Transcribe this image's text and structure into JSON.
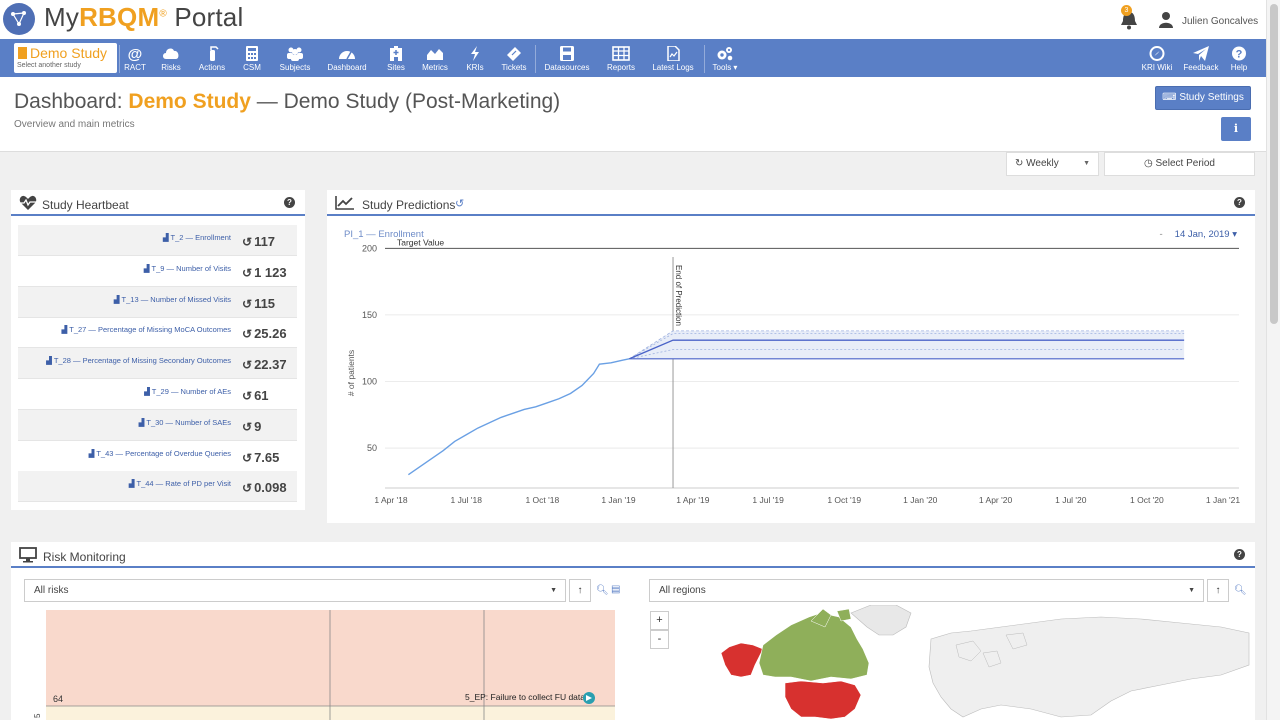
{
  "app": {
    "brand_prefix": "My",
    "brand_accent": "RBQM",
    "brand_reg": "®",
    "brand_suffix": " Portal",
    "notification_count": "3",
    "username": "Julien Goncalves"
  },
  "nav": {
    "study_name": "Demo Study",
    "study_hint": "Select another study",
    "items": [
      {
        "label": "RACT",
        "icon": "at-icon"
      },
      {
        "label": "Risks",
        "icon": "cloud-icon"
      },
      {
        "label": "Actions",
        "icon": "fire-extinguisher-icon"
      },
      {
        "label": "CSM",
        "icon": "calculator-icon"
      },
      {
        "label": "Subjects",
        "icon": "users-icon"
      },
      {
        "label": "Dashboard",
        "icon": "dashboard-icon"
      },
      {
        "label": "Sites",
        "icon": "hospital-icon"
      },
      {
        "label": "Metrics",
        "icon": "area-chart-icon"
      },
      {
        "label": "KRIs",
        "icon": "bolt-icon"
      },
      {
        "label": "Tickets",
        "icon": "ticket-icon"
      },
      {
        "label": "Datasources",
        "icon": "save-icon"
      },
      {
        "label": "Reports",
        "icon": "table-icon"
      },
      {
        "label": "Latest Logs",
        "icon": "file-icon"
      },
      {
        "label": "Tools ▾",
        "icon": "cogs-icon"
      }
    ],
    "right_items": [
      {
        "label": "KRI Wiki",
        "icon": "compass-icon"
      },
      {
        "label": "Feedback",
        "icon": "paper-plane-icon"
      },
      {
        "label": "Help",
        "icon": "question-icon"
      }
    ]
  },
  "header": {
    "title_prefix": "Dashboard: ",
    "title_study": "Demo Study",
    "title_suffix": " — Demo Study (Post-Marketing)",
    "subtitle": "Overview and main metrics",
    "settings_button": "Study Settings",
    "info_button": "i"
  },
  "period": {
    "frequency": "Weekly",
    "select_label": "Select Period"
  },
  "heartbeat": {
    "title": "Study Heartbeat",
    "rows": [
      {
        "label": "T_2 — Enrollment",
        "value": "117"
      },
      {
        "label": "T_9 — Number of Visits",
        "value": "1 123"
      },
      {
        "label": "T_13 — Number of Missed Visits",
        "value": "115"
      },
      {
        "label": "T_27 — Percentage of Missing MoCA Outcomes",
        "value": "25.26"
      },
      {
        "label": "T_28 — Percentage of Missing Secondary Outcomes",
        "value": "22.37"
      },
      {
        "label": "T_29 — Number of AEs",
        "value": "61"
      },
      {
        "label": "T_30 — Number of SAEs",
        "value": "9"
      },
      {
        "label": "T_43 — Percentage of Overdue Queries",
        "value": "7.65"
      },
      {
        "label": "T_44 — Rate of PD per Visit",
        "value": "0.098"
      }
    ]
  },
  "predictions": {
    "title": "Study Predictions",
    "subtitle": "PI_1 — Enrollment",
    "date_dash": "-",
    "date": "14 Jan, 2019 ▾",
    "target_label": "Target Value",
    "end_label": "End of Prediction"
  },
  "chart_data": {
    "type": "line",
    "title": "",
    "xlabel": "",
    "ylabel": "# of patients",
    "x_ticks": [
      "1 Apr '18",
      "1 Jul '18",
      "1 Oct '18",
      "1 Jan '19",
      "1 Apr '19",
      "1 Jul '19",
      "1 Oct '19",
      "1 Jan '20",
      "1 Apr '20",
      "1 Jul '20",
      "1 Oct '20",
      "1 Jan '21"
    ],
    "y_ticks": [
      50,
      100,
      150,
      200
    ],
    "ylim": [
      20,
      210
    ],
    "target_value": 200,
    "end_of_prediction": "2019-03-08",
    "grid": true,
    "series": [
      {
        "values": [
          {
            "x": "2018-04-22",
            "y": 30
          },
          {
            "x": "2018-05-06",
            "y": 36
          },
          {
            "x": "2018-05-20",
            "y": 42
          },
          {
            "x": "2018-06-03",
            "y": 48
          },
          {
            "x": "2018-06-17",
            "y": 55
          },
          {
            "x": "2018-07-01",
            "y": 60
          },
          {
            "x": "2018-07-15",
            "y": 65
          },
          {
            "x": "2018-07-29",
            "y": 69
          },
          {
            "x": "2018-08-12",
            "y": 73
          },
          {
            "x": "2018-08-26",
            "y": 76
          },
          {
            "x": "2018-09-09",
            "y": 79
          },
          {
            "x": "2018-09-23",
            "y": 81
          },
          {
            "x": "2018-10-07",
            "y": 84
          },
          {
            "x": "2018-10-21",
            "y": 87
          },
          {
            "x": "2018-11-04",
            "y": 91
          },
          {
            "x": "2018-11-18",
            "y": 97
          },
          {
            "x": "2018-12-02",
            "y": 106
          },
          {
            "x": "2018-12-09",
            "y": 113
          },
          {
            "x": "2018-12-23",
            "y": 114
          },
          {
            "x": "2019-01-06",
            "y": 116
          },
          {
            "x": "2019-01-14",
            "y": 117
          }
        ]
      }
    ],
    "prediction": {
      "start": {
        "x": "2019-01-14",
        "y": 117
      },
      "end_x": "2020-11-15",
      "upper": 138,
      "upper_inner": 136,
      "center": 131,
      "lower_inner": 124,
      "lower": 117
    }
  },
  "risk_monitoring": {
    "title": "Risk Monitoring",
    "risks_select": "All risks",
    "regions_select": "All regions",
    "sort_icon": "↑",
    "zoom_in": "+",
    "zoom_out": "-",
    "risk_value": "64",
    "risk_label": "5_EP: Failure to collect FU data",
    "axis_tick": "5"
  }
}
